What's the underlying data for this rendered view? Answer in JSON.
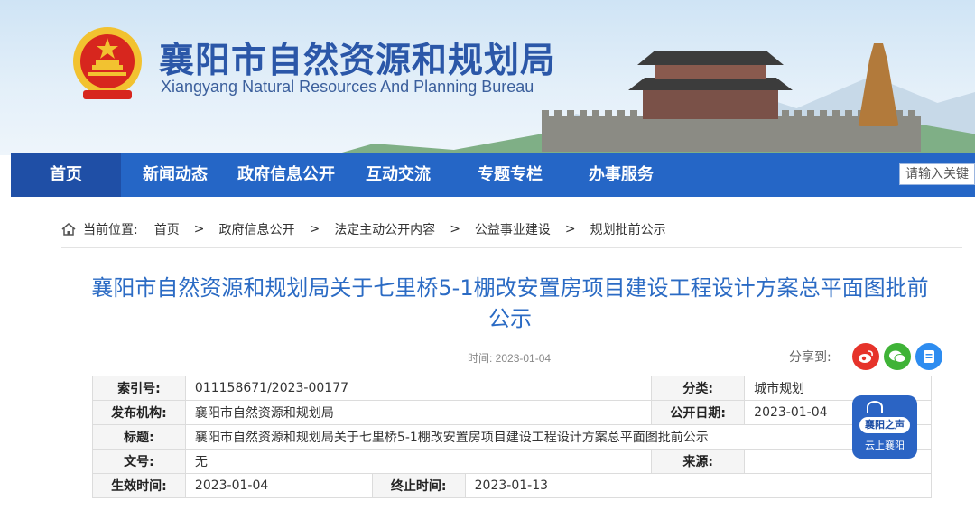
{
  "header": {
    "title": "襄阳市自然资源和规划局",
    "subtitle": "Xiangyang Natural Resources And Planning Bureau"
  },
  "nav": {
    "items": [
      "首页",
      "新闻动态",
      "政府信息公开",
      "互动交流",
      "专题专栏",
      "办事服务"
    ],
    "search_placeholder": "请输入关键"
  },
  "breadcrumb": {
    "label": "当前位置:",
    "items": [
      "首页",
      "政府信息公开",
      "法定主动公开内容",
      "公益事业建设",
      "规划批前公示"
    ],
    "separator": ">"
  },
  "article": {
    "title": "襄阳市自然资源和规划局关于七里桥5-1棚改安置房项目建设工程设计方案总平面图批前公示",
    "date": "时间: 2023-01-04",
    "share_label": "分享到:"
  },
  "info_table": {
    "index_label": "索引号:",
    "index_value": "011158671/2023-00177",
    "category_label": "分类:",
    "category_value": "城市规划",
    "publisher_label": "发布机构:",
    "publisher_value": "襄阳市自然资源和规划局",
    "publish_date_label": "公开日期:",
    "publish_date_value": "2023-01-04",
    "title_label": "标题:",
    "title_value": "襄阳市自然资源和规划局关于七里桥5-1棚改安置房项目建设工程设计方案总平面图批前公示",
    "doc_no_label": "文号:",
    "doc_no_value": "无",
    "source_label": "来源:",
    "source_value": "",
    "effective_label": "生效时间:",
    "effective_value": "2023-01-04",
    "end_label": "终止时间:",
    "end_value": "2023-01-13"
  },
  "badge": {
    "line1": "襄阳之声",
    "line2": "云上襄阳"
  },
  "colors": {
    "nav_bg": "#2566c6",
    "title_blue": "#2b6bc4",
    "weibo": "#e6332a",
    "wechat": "#3fb337",
    "qzone": "#2d8cf0"
  }
}
